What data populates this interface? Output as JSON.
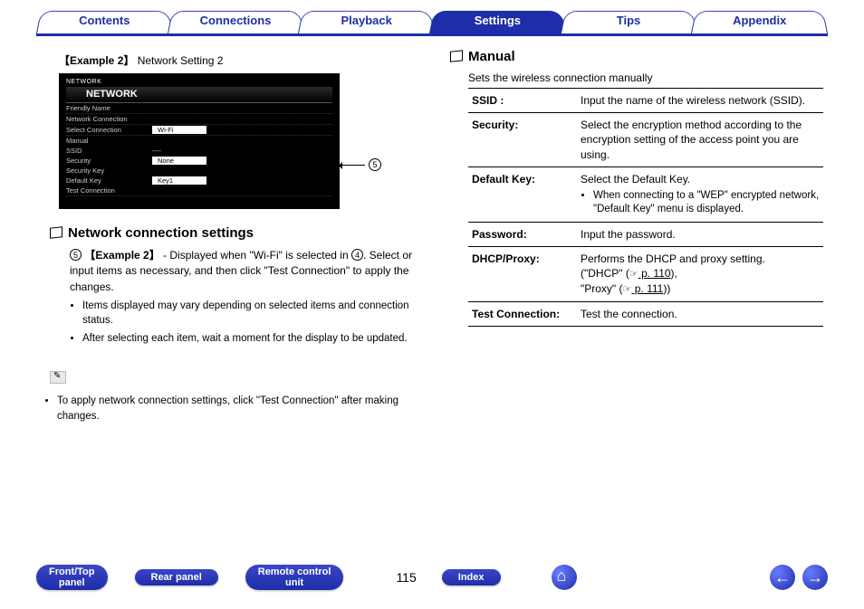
{
  "tabs": {
    "contents": "Contents",
    "connections": "Connections",
    "playback": "Playback",
    "settings": "Settings",
    "tips": "Tips",
    "appendix": "Appendix"
  },
  "left": {
    "example_tag": "【Example 2】",
    "example_title": "Network Setting 2",
    "device": {
      "crumb": "NETWORK",
      "title": "NETWORK",
      "rows": {
        "friendly": {
          "lbl": "Friendly Name",
          "val": ""
        },
        "netconn": {
          "lbl": "Network Connection",
          "val": ""
        },
        "selconn": {
          "lbl": "Select Connection",
          "val": "Wi-Fi"
        },
        "manual": {
          "lbl": "Manual",
          "val": ""
        },
        "ssid": {
          "lbl": "SSID",
          "val": "----"
        },
        "security": {
          "lbl": "Security",
          "val": "None"
        },
        "seckey": {
          "lbl": "Security Key",
          "val": ""
        },
        "defkey": {
          "lbl": "Default Key",
          "val": "Key1"
        },
        "test": {
          "lbl": "Test Connection",
          "val": ""
        }
      },
      "callout_num": "5"
    },
    "section_heading": "Network connection settings",
    "para_num": "5",
    "para_bold": "【Example 2】",
    "para_text1": " - Displayed when \"Wi-Fi\" is selected in ",
    "para_num2": "4",
    "para_text2": ". Select or input items as necessary, and then click \"Test Connection\" to apply the changes.",
    "bullets": [
      "Items displayed may vary depending on selected items and connection status.",
      "After selecting each item, wait a moment for the display to be updated."
    ],
    "note": "To apply network connection settings, click \"Test Connection\" after making changes."
  },
  "right": {
    "heading": "Manual",
    "intro": "Sets the wireless connection manually",
    "rows": {
      "ssid": {
        "key": "SSID :",
        "desc": "Input the name of the wireless network (SSID)."
      },
      "security": {
        "key": "Security:",
        "desc": "Select the encryption method according to the encryption setting of the access point you are using."
      },
      "defkey": {
        "key": "Default Key:",
        "desc_pre": "Select the Default Key.",
        "bullet": "When connecting to a \"WEP\" encrypted network, \"Default Key\" menu is displayed."
      },
      "password": {
        "key": "Password:",
        "desc": "Input the password."
      },
      "dhcp": {
        "key": "DHCP/Proxy:",
        "desc_pre": "Performs the DHCP and proxy setting.",
        "l1a": "(\"DHCP\" (",
        "l1_link": " p. 110",
        "l1b": "),",
        "l2a": "\"Proxy\" (",
        "l2_link": " p. 111",
        "l2b": "))"
      },
      "test": {
        "key": "Test Connection:",
        "desc": "Test the connection."
      }
    }
  },
  "footer": {
    "front": "Front/Top\npanel",
    "rear": "Rear panel",
    "remote": "Remote control\nunit",
    "index": "Index",
    "page": "115"
  }
}
